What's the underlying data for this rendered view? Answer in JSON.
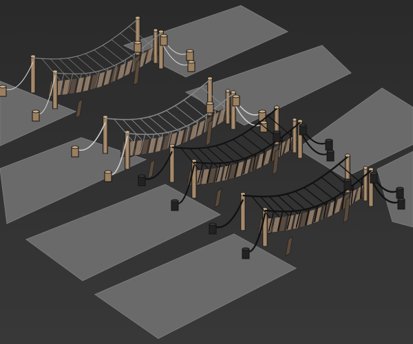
{
  "viewport": {
    "background_top": "#2a2a2a",
    "background_bottom": "#383838",
    "ground_color": "#6a6a6a",
    "ground_edge": "#7c7c7c",
    "plank_color": "#8c7662",
    "plank_dark": "#5a4b3e",
    "post_color": "#a58a6a",
    "wire_color": "#111111",
    "rope_light": "#cfcfcf"
  },
  "bridges": [
    {
      "id": "lod-0",
      "label": ""
    },
    {
      "id": "lod-1",
      "label": ""
    },
    {
      "id": "lod-2",
      "label": ""
    },
    {
      "id": "lod-3",
      "label": ""
    }
  ]
}
